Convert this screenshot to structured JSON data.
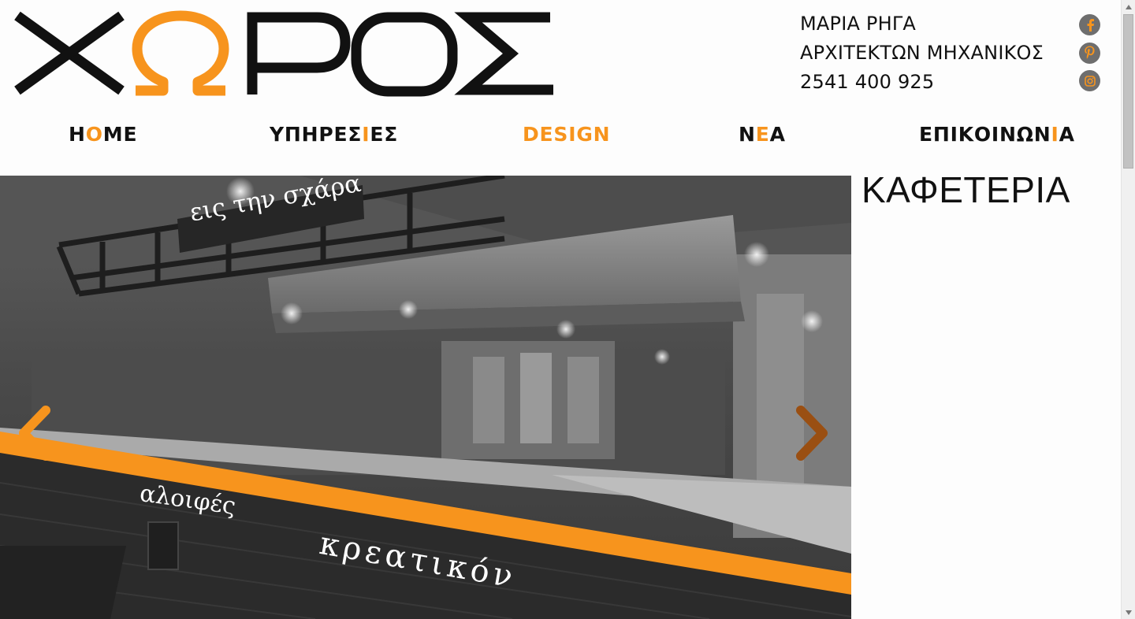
{
  "brand": {
    "logo_letters": [
      "Χ",
      "Ω",
      "Ρ",
      "Ο",
      "Σ"
    ],
    "accent_color": "#f7941d",
    "text_color": "#111111"
  },
  "contact": {
    "name": "ΜΑΡΙΑ ΡΗΓΑ",
    "title": "ΑΡΧΙΤΕΚΤΩΝ ΜΗΧΑΝΙΚΟΣ",
    "phone": "2541 400 925"
  },
  "social": [
    {
      "icon": "facebook-icon"
    },
    {
      "icon": "pinterest-icon"
    },
    {
      "icon": "instagram-icon"
    }
  ],
  "nav": {
    "items": [
      {
        "pre": "H",
        "hl": "O",
        "post": "ME",
        "active": false
      },
      {
        "pre": "ΥΠΗΡΕΣ",
        "hl": "Ι",
        "post": "ΕΣ",
        "active": false
      },
      {
        "pre": "DESIGN",
        "hl": "",
        "post": "",
        "active": true
      },
      {
        "pre": "Ν",
        "hl": "Ε",
        "post": "Α",
        "active": false
      },
      {
        "pre": "ΕΠΙΚΟΙΝΩΝ",
        "hl": "Ι",
        "post": "Α",
        "active": false
      }
    ]
  },
  "slider": {
    "sign_top": "εις την σχάρα",
    "sign_left": "αλοιφές",
    "sign_bottom": "κρεατικόν",
    "prev_icon": "chevron-left-icon",
    "next_icon": "chevron-right-icon"
  },
  "panel": {
    "title": "ΚΑΦΕΤΕΡΙΑ"
  }
}
